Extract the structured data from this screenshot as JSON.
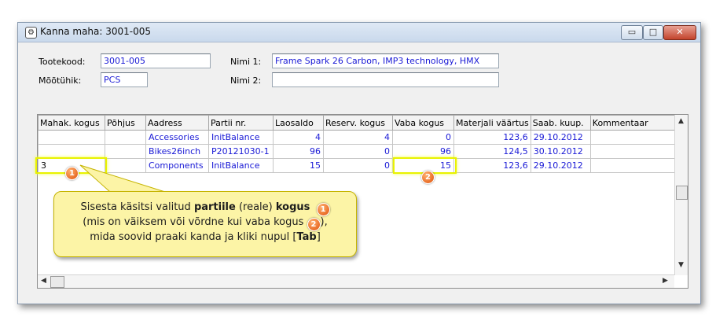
{
  "window": {
    "title": "Kanna maha: 3001-005",
    "buttons": {
      "minimize": "▭",
      "maximize": "□",
      "close": "✕"
    }
  },
  "form": {
    "tootekood_label": "Tootekood:",
    "tootekood_value": "3001-005",
    "mootuhik_label": "Mõõtühik:",
    "mootuhik_value": "PCS",
    "nimi1_label": "Nimi 1:",
    "nimi1_value": "Frame Spark 26 Carbon, IMP3 technology, HMX",
    "nimi2_label": "Nimi 2:",
    "nimi2_value": ""
  },
  "grid": {
    "columns": [
      "Mahak. kogus",
      "Põhjus",
      "Aadress",
      "Partii nr.",
      "Laosaldo",
      "Reserv. kogus",
      "Vaba kogus",
      "Materjali väärtus",
      "Saab. kuup.",
      "Kommentaar"
    ],
    "rows": [
      {
        "mahak": "",
        "pohjus": "",
        "aadress": "Accessories",
        "partii": "InitBalance",
        "laosaldo": "4",
        "reserv": "4",
        "vaba": "0",
        "vaartus": "123,6",
        "kuup": "29.10.2012",
        "kommentaar": ""
      },
      {
        "mahak": "",
        "pohjus": "",
        "aadress": "Bikes26inch",
        "partii": "P20121030-1",
        "laosaldo": "96",
        "reserv": "0",
        "vaba": "96",
        "vaartus": "124,5",
        "kuup": "30.10.2012",
        "kommentaar": ""
      },
      {
        "mahak": "3",
        "pohjus": "",
        "aadress": "Components",
        "partii": "InitBalance",
        "laosaldo": "15",
        "reserv": "0",
        "vaba": "15",
        "vaartus": "123,6",
        "kuup": "29.10.2012",
        "kommentaar": ""
      }
    ]
  },
  "badges": {
    "one": "1",
    "two": "2"
  },
  "callout": {
    "line1_a": "Sisesta käsitsi valitud ",
    "line1_b": "partiile",
    "line1_c": " (reale) ",
    "line1_d": "kogus",
    "line2_a": "(mis on väiksem või võrdne kui vaba kogus ",
    "line2_b": "),",
    "line3_a": "mida soovid praaki kanda ja kliki nupul [",
    "line3_b": "Tab",
    "line3_c": "]"
  },
  "colors": {
    "value_text": "#1a1ad6",
    "highlight": "#e9f200",
    "callout_bg": "#fcf4a6",
    "badge": "#e0520a"
  }
}
